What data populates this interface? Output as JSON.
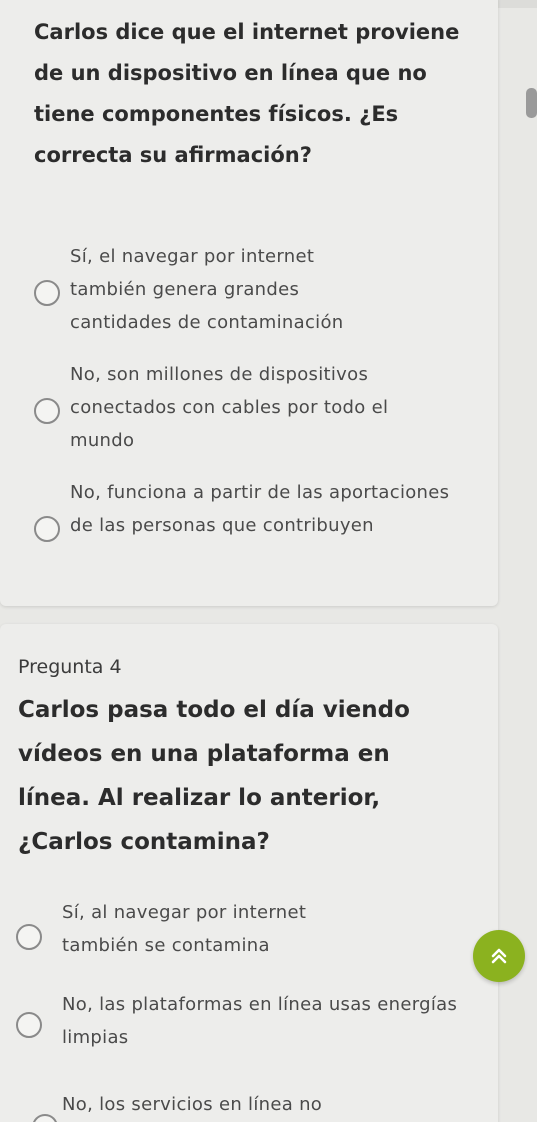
{
  "question3": {
    "text": "Carlos dice que el internet proviene de un dispositivo en línea que no tiene componentes físicos. ¿Es correcta su afirmación?",
    "options": [
      "Sí, el navegar por internet también genera grandes cantidades de contaminación",
      "No, son millones de dispositivos conectados con cables por todo el mundo",
      "No, funciona a partir de las aportaciones de las personas que contribuyen"
    ]
  },
  "question4": {
    "label": "Pregunta 4",
    "text": "Carlos pasa todo el día viendo vídeos en una plataforma en línea. Al realizar lo anterior, ¿Carlos contamina?",
    "options": [
      "Sí, al navegar por internet también se contamina",
      "No, las plataformas en línea usas energías limpias",
      "No, los servicios en línea no"
    ]
  },
  "scroll_button": {
    "icon": "double-chevron-up-icon",
    "color": "#8bb21f"
  }
}
